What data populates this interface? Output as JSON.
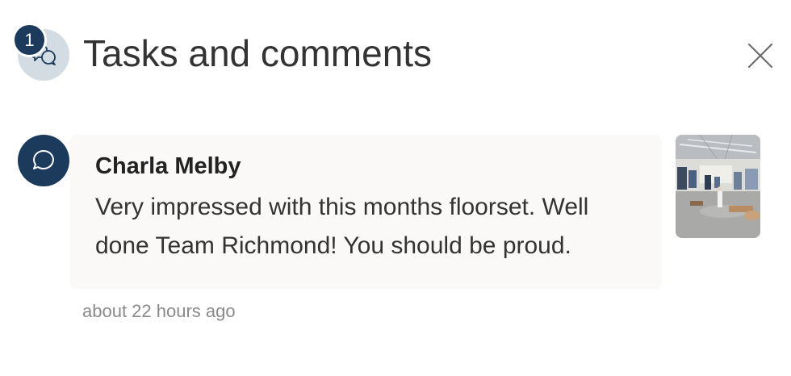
{
  "header": {
    "title": "Tasks and comments",
    "badge_count": "1",
    "icon": "comments-icon",
    "close_icon": "close-icon"
  },
  "comment": {
    "author": "Charla Melby",
    "text": "Very impressed with this months floorset. Well done Team Richmond! You should be proud.",
    "timestamp": "about 22 hours ago",
    "avatar_icon": "speech-bubble-icon",
    "attachment_icon": "store-photo-thumbnail"
  },
  "colors": {
    "navy": "#1b3a5c",
    "header_icon_bg": "#d3dbe3",
    "card_bg": "#faf9f8",
    "timestamp": "#8a8a8a"
  }
}
